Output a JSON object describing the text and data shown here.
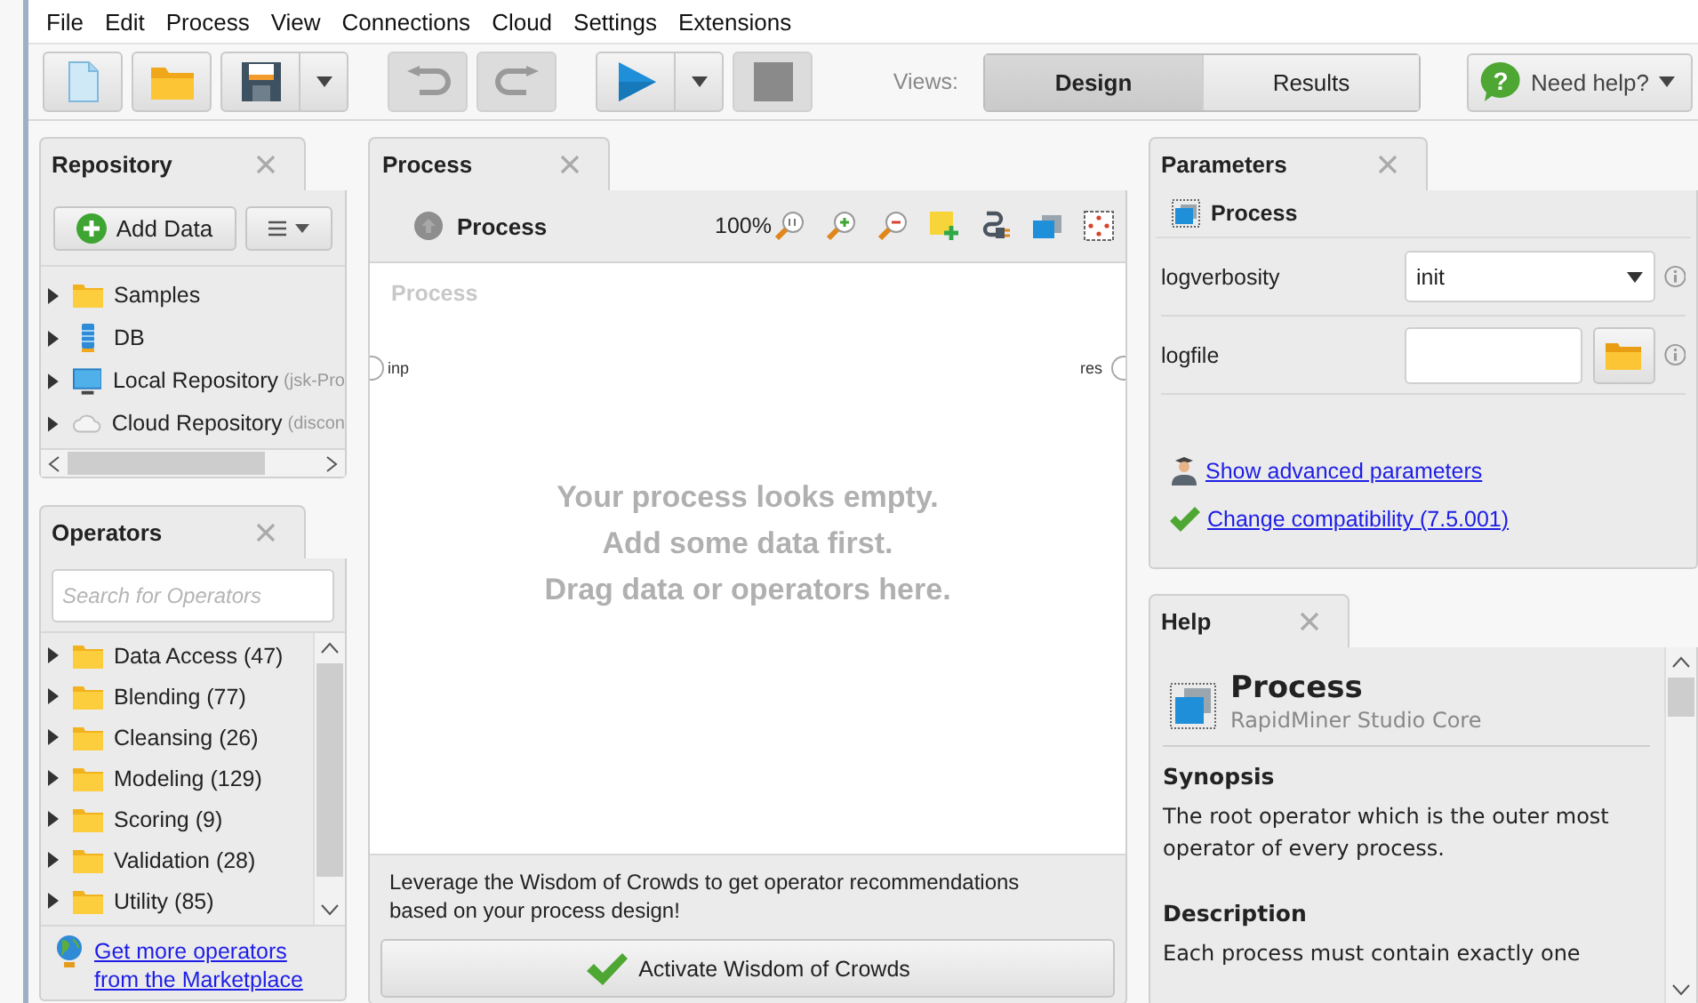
{
  "menu": [
    "File",
    "Edit",
    "Process",
    "View",
    "Connections",
    "Cloud",
    "Settings",
    "Extensions"
  ],
  "toolbar": [
    {
      "kind": "new",
      "disabled": false
    },
    {
      "kind": "open",
      "disabled": false
    },
    {
      "kind": "save",
      "disabled": false
    },
    {
      "kind": "save-menu",
      "disabled": false
    },
    {
      "kind": "undo",
      "disabled": true
    },
    {
      "kind": "redo",
      "disabled": true
    },
    {
      "kind": "run",
      "disabled": false
    },
    {
      "kind": "run-menu",
      "disabled": false
    },
    {
      "kind": "stop",
      "disabled": true
    }
  ],
  "views": {
    "label": "Views:",
    "tabs": [
      {
        "label": "Design",
        "selected": true
      },
      {
        "label": "Results",
        "selected": false
      }
    ]
  },
  "help_button": {
    "icon_glyph": "?",
    "label": "Need help?"
  },
  "repository": {
    "title": "Repository",
    "add_data": "Add Data",
    "items": [
      {
        "kind": "folder",
        "label": "Samples",
        "expanded": false
      },
      {
        "kind": "db",
        "label": "DB",
        "expanded": false
      },
      {
        "kind": "local",
        "label": "Local Repository",
        "note": "(jsk-Pro",
        "expanded": false
      },
      {
        "kind": "cloud",
        "label": "Cloud Repository",
        "note": "(discon",
        "expanded": false
      }
    ]
  },
  "operators": {
    "title": "Operators",
    "search_placeholder": "Search for Operators",
    "items": [
      {
        "label": "Data Access (47)",
        "expanded": false
      },
      {
        "label": "Blending (77)",
        "expanded": false
      },
      {
        "label": "Cleansing (26)",
        "expanded": false
      },
      {
        "label": "Modeling (129)",
        "expanded": false
      },
      {
        "label": "Scoring (9)",
        "expanded": false
      },
      {
        "label": "Validation (28)",
        "expanded": false
      },
      {
        "label": "Utility (85)",
        "expanded": false
      }
    ],
    "marketplace_link": "Get more operators from the Marketplace"
  },
  "process": {
    "title": "Process",
    "breadcrumb": "Process",
    "zoom": "100%",
    "canvas_label": "Process",
    "input_port": "inp",
    "output_port": "res",
    "empty_message": [
      "Your process looks empty.",
      "Add some data first.",
      "Drag data or operators here."
    ],
    "wisdom_text": "Leverage the Wisdom of Crowds to get operator recommendations based on your process design!",
    "wisdom_button": "Activate Wisdom of Crowds"
  },
  "parameters": {
    "title": "Parameters",
    "operator": "Process",
    "rows": [
      {
        "kind": "select",
        "name": "logverbosity",
        "value": "init"
      },
      {
        "kind": "file",
        "name": "logfile"
      }
    ],
    "links": [
      {
        "kind": "advanced",
        "label": "Show advanced parameters"
      },
      {
        "kind": "compatibility",
        "label": "Change compatibility (7.5.001)"
      }
    ]
  },
  "help": {
    "title": "Help",
    "operator": "Process",
    "subtitle": "RapidMiner Studio Core",
    "sections": [
      {
        "heading": "Synopsis",
        "text": "The root operator which is the outer most operator of every process."
      },
      {
        "heading": "Description",
        "text": "Each process must contain exactly one"
      }
    ]
  }
}
